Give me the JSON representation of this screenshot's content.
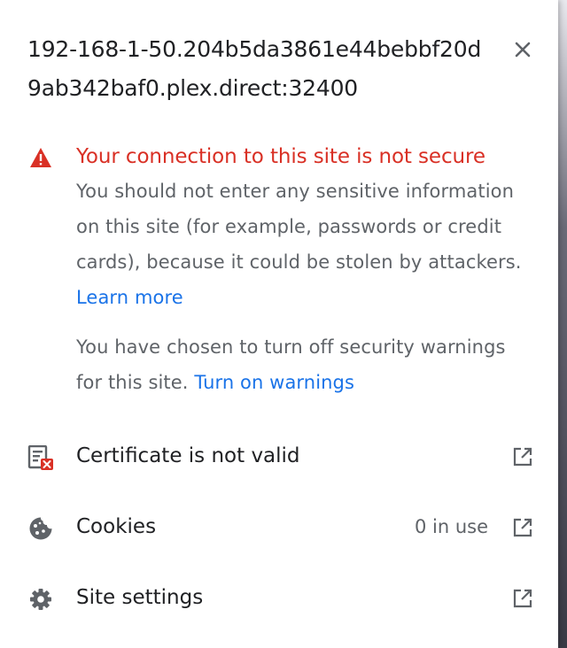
{
  "site": {
    "host_line_1": "192-168-1-50.204b5da3861e44bebbf20d",
    "host_line_2": "9ab342baf0.plex.direct:32400"
  },
  "security": {
    "title": "Your connection to this site is not secure",
    "description": "You should not enter any sensitive information on this site (for example, passwords or credit cards), because it could be stolen by attackers.",
    "learn_more": "Learn more",
    "warnings_off_text": "You have chosen to turn off security warnings for this site.",
    "turn_on_warnings": "Turn on warnings"
  },
  "rows": {
    "certificate": {
      "label": "Certificate is not valid"
    },
    "cookies": {
      "label": "Cookies",
      "value": "0 in use"
    },
    "site_settings": {
      "label": "Site settings"
    }
  },
  "icons": {
    "close": "close-icon",
    "warning": "warning-triangle-icon",
    "certificate": "certificate-invalid-icon",
    "cookies": "cookie-icon",
    "settings": "gear-icon",
    "external": "open-in-new-icon"
  },
  "colors": {
    "danger": "#d93025",
    "link": "#1a73e8",
    "text_primary": "#202124",
    "text_secondary": "#5f6368",
    "icon": "#5f6368"
  }
}
